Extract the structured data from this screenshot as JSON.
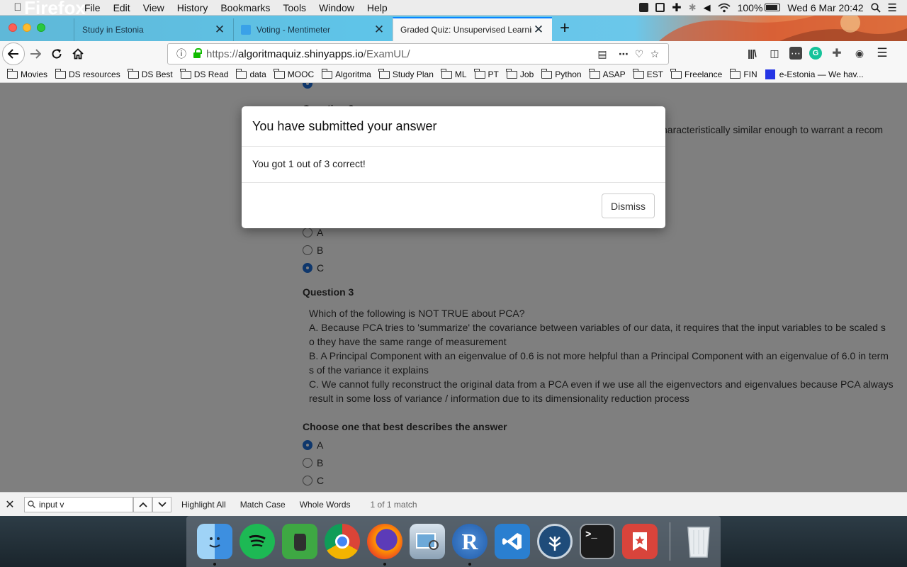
{
  "menubar": {
    "app_name": "Firefox",
    "menus": [
      "File",
      "Edit",
      "View",
      "History",
      "Bookmarks",
      "Tools",
      "Window",
      "Help"
    ],
    "battery": "100%",
    "datetime": "Wed 6 Mar  20:42"
  },
  "tabs": [
    {
      "title": "Study in Estonia",
      "active": false
    },
    {
      "title": "Voting - Mentimeter",
      "active": false
    },
    {
      "title": "Graded Quiz: Unsupervised Learning",
      "active": true
    }
  ],
  "urlbar": {
    "scheme": "https://",
    "host": "algoritmaquiz.shinyapps.io",
    "path": "/ExamUL/"
  },
  "bookmarks": [
    {
      "label": "Movies",
      "icon": "folder-icon"
    },
    {
      "label": "DS resources",
      "icon": "folder-icon"
    },
    {
      "label": "DS Best",
      "icon": "folder-icon"
    },
    {
      "label": "DS Read",
      "icon": "folder-icon"
    },
    {
      "label": "data",
      "icon": "folder-icon"
    },
    {
      "label": "MOOC",
      "icon": "folder-icon"
    },
    {
      "label": "Algoritma",
      "icon": "folder-icon"
    },
    {
      "label": "Study Plan",
      "icon": "folder-icon"
    },
    {
      "label": "ML",
      "icon": "folder-icon"
    },
    {
      "label": "PT",
      "icon": "folder-icon"
    },
    {
      "label": "Job",
      "icon": "folder-icon"
    },
    {
      "label": "Python",
      "icon": "folder-icon"
    },
    {
      "label": "ASAP",
      "icon": "folder-icon"
    },
    {
      "label": "EST",
      "icon": "folder-icon"
    },
    {
      "label": "Freelance",
      "icon": "folder-icon"
    },
    {
      "label": "FIN",
      "icon": "folder-icon"
    },
    {
      "label": "e-Estonia — We hav...",
      "icon": "site-favicon"
    }
  ],
  "page": {
    "partial_top": {
      "question_label": "Question 2",
      "question_text_tail": "characteristically similar enough to warrant a recom",
      "options": [
        {
          "label": "A",
          "selected": false
        },
        {
          "label": "B",
          "selected": false
        },
        {
          "label": "C",
          "selected": true
        }
      ]
    },
    "question3": {
      "label": "Question 3",
      "lines": [
        "Which of the following is NOT TRUE about PCA?",
        "A.  Because PCA tries to 'summarize' the covariance between variables of our data, it requires that the input variables to be scaled s",
        "o they have the same range of measurement",
        "B.  A Principal Component with an eigenvalue of 0.6 is not more helpful than a Principal Component with an eigenvalue of 6.0 in term",
        "s of the variance it explains",
        "C.  We cannot fully reconstruct the original data from a PCA even if we use all the eigenvectors and eigenvalues because PCA always",
        "result in some loss of variance / information due to its dimensionality reduction process"
      ],
      "prompt": "Choose one that best describes the answer",
      "options": [
        {
          "label": "A",
          "selected": true
        },
        {
          "label": "B",
          "selected": false
        },
        {
          "label": "C",
          "selected": false
        }
      ]
    }
  },
  "modal": {
    "title": "You have submitted your answer",
    "body": "You got 1 out of 3 correct!",
    "dismiss_label": "Dismiss"
  },
  "findbar": {
    "query": "input v",
    "highlight_all": "Highlight All",
    "match_case": "Match Case",
    "whole_words": "Whole Words",
    "result": "1 of 1 match"
  },
  "dock": [
    {
      "name": "finder",
      "running": true,
      "color": "#3d8fe0"
    },
    {
      "name": "spotify",
      "running": false,
      "color": "#1db954"
    },
    {
      "name": "evernote",
      "running": false,
      "color": "#3ea843"
    },
    {
      "name": "chrome",
      "running": false,
      "color": "#e8e8e8"
    },
    {
      "name": "firefox",
      "running": true,
      "color": "#e8632b"
    },
    {
      "name": "preview",
      "running": false,
      "color": "#9aa7b5"
    },
    {
      "name": "r",
      "running": true,
      "color": "#2b6bc0"
    },
    {
      "name": "vscode",
      "running": false,
      "color": "#2a7fd0"
    },
    {
      "name": "sourcetree",
      "running": false,
      "color": "#1f4c7a"
    },
    {
      "name": "terminal",
      "running": false,
      "color": "#2b2b2b"
    },
    {
      "name": "wunderlist",
      "running": false,
      "color": "#d9443b"
    },
    {
      "name": "trash",
      "running": false,
      "color": "#d9dde0"
    }
  ],
  "colors": {
    "accent": "#0a84ff",
    "radio_selected": "#1e6fd9",
    "overlay": "rgba(0,0,0,0.5)"
  }
}
